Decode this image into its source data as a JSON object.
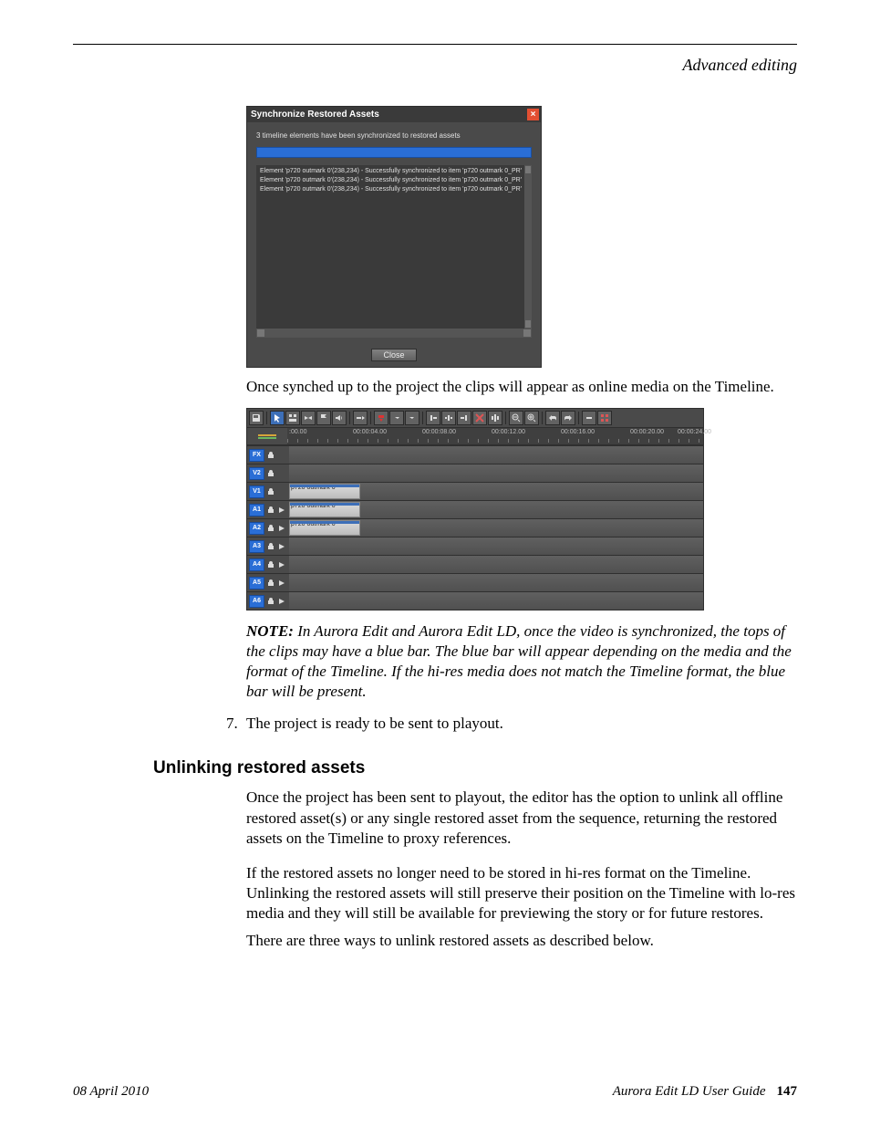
{
  "header": {
    "section_title": "Advanced editing"
  },
  "dialog": {
    "title": "Synchronize Restored Assets",
    "message": "3 timeline elements have been synchronized to restored assets",
    "log_lines": [
      "Element 'p720 outmark 0'(238,234) - Successfully synchronized to item 'p720 outmark 0_PR'",
      "Element 'p720 outmark 0'(238,234) - Successfully synchronized to item 'p720 outmark 0_PR'",
      "Element 'p720 outmark 0'(238,234) - Successfully synchronized to item 'p720 outmark 0_PR'"
    ],
    "close_label": "Close"
  },
  "para1": "Once synched up to the project the clips will appear as online media on the Timeline.",
  "timeline": {
    "ruler": [
      ":00.00",
      "00:00:04.00",
      "00:00:08.00",
      "00:00:12.00",
      "00:00:16.00",
      "00:00:20.00",
      "00:00:24.00"
    ],
    "tracks": [
      {
        "label": "FX",
        "has_play": false,
        "clip": null
      },
      {
        "label": "V2",
        "has_play": false,
        "clip": null
      },
      {
        "label": "V1",
        "has_play": false,
        "clip": "p720 outmark 0"
      },
      {
        "label": "A1",
        "has_play": true,
        "clip": "p720 outmark 0"
      },
      {
        "label": "A2",
        "has_play": true,
        "clip": "p720 outmark 0"
      },
      {
        "label": "A3",
        "has_play": true,
        "clip": null
      },
      {
        "label": "A4",
        "has_play": true,
        "clip": null
      },
      {
        "label": "A5",
        "has_play": true,
        "clip": null
      },
      {
        "label": "A6",
        "has_play": true,
        "clip": null
      }
    ]
  },
  "note": {
    "lead": "NOTE:  ",
    "text": "In Aurora Edit and Aurora Edit LD, once the video is synchronized, the tops of the clips may have a blue bar. The blue bar will appear depending on the media and the format of the Timeline. If the hi-res media does not match the Timeline format, the blue bar will be present."
  },
  "list_item": {
    "num": "7.",
    "text": "The project is ready to be sent to playout."
  },
  "section2": {
    "heading": "Unlinking restored assets",
    "p1": "Once the project has been sent to playout, the editor has the option to unlink all offline restored asset(s) or any single restored asset from the sequence, returning the restored assets on the Timeline to proxy references.",
    "p2": "If the restored assets no longer need to be stored in hi-res format on the Timeline. Unlinking the restored assets will still preserve their position on the Timeline with lo-res media and they will still be available for previewing the story or for future restores.",
    "p3": "There are three ways to unlink restored assets as described below."
  },
  "footer": {
    "date": "08 April 2010",
    "book": "Aurora Edit LD User Guide",
    "page": "147"
  }
}
